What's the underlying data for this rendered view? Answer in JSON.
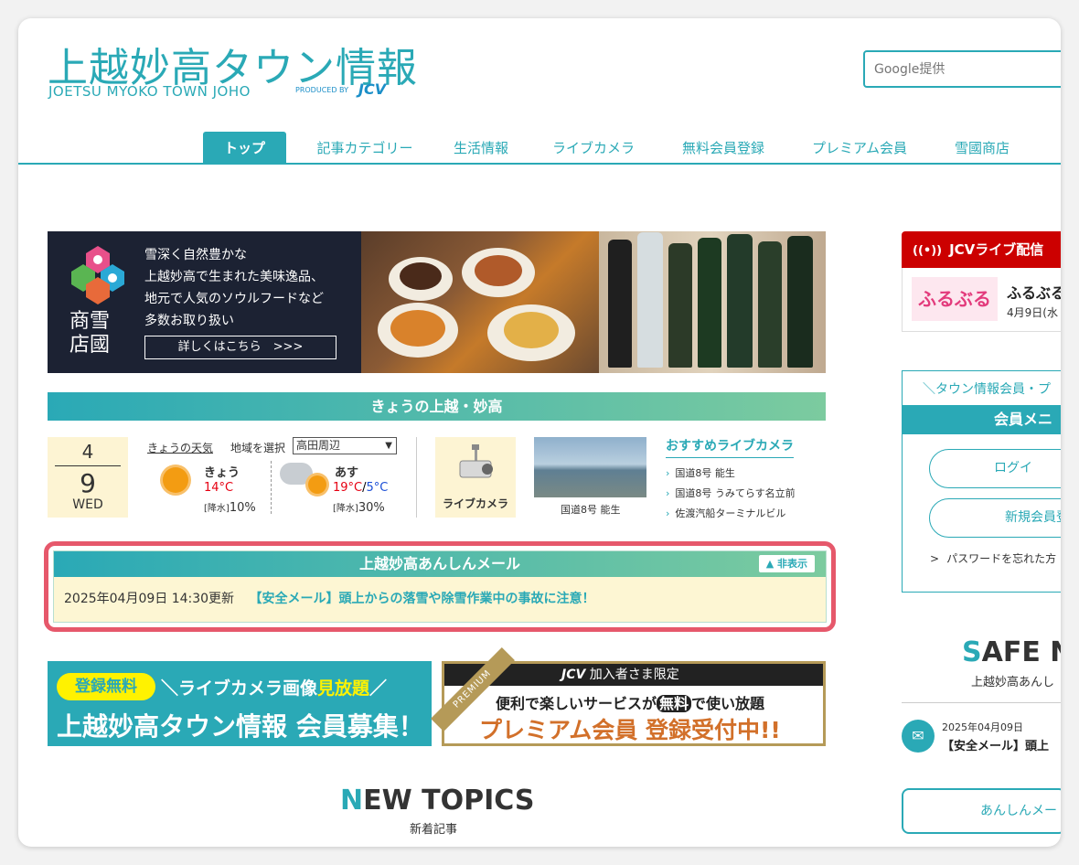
{
  "header": {
    "site_title": "上越妙高タウン情報",
    "site_subtitle": "JOETSU MYOKO TOWN JOHO",
    "produced_by": "PRODUCED BY",
    "brand": "JCV",
    "search_placeholder": "Google提供"
  },
  "nav": {
    "items": [
      "トップ",
      "記事カテゴリー",
      "生活情報",
      "ライブカメラ",
      "無料会員登録",
      "プレミアム会員",
      "雪國商店"
    ]
  },
  "banner": {
    "lines": [
      "雪深く自然豊かな",
      "上越妙高で生まれた美味逸品、",
      "地元で人気のソウルフードなど",
      "多数お取り扱い"
    ],
    "button_label": "詳しくはこちら　>>>",
    "shop_name": "商雪\n店國"
  },
  "today": {
    "heading": "きょうの上越・妙高",
    "month": "4",
    "day": "9",
    "weekday": "WED",
    "weather_link": "きょうの天気",
    "region_label": "地域を選択",
    "region_value": "高田周辺",
    "today_label": "きょう",
    "today_temp": "14°C",
    "today_rain_label": "[降水]",
    "today_rain": "10%",
    "tomorrow_label": "あす",
    "tomorrow_high": "19°C",
    "tomorrow_sep": "/",
    "tomorrow_low": "5°C",
    "tomorrow_rain_label": "[降水]",
    "tomorrow_rain": "30%",
    "camera_label": "ライブカメラ",
    "camera_thumb_caption": "国道8号 能生",
    "recommend_title": "おすすめライブカメラ",
    "recommend_links": [
      "国道8号 能生",
      "国道8号 うみてらす名立前",
      "佐渡汽船ターミナルビル"
    ]
  },
  "alert": {
    "title": "上越妙高あんしんメール",
    "hide_label": "▲ 非表示",
    "updated": "2025年04月09日 14:30更新",
    "message": "【安全メール】頭上からの落雪や除雪作業中の事故に注意！"
  },
  "promo1": {
    "badge": "登録無料",
    "line1_a": "＼ライブカメラ画像",
    "line1_b": "見放題",
    "line1_c": "／",
    "line2": "上越妙高タウン情報 会員募集！"
  },
  "promo2": {
    "ribbon": "PREMIUM",
    "head_brand": "JCV",
    "head_text": "加入者さま限定",
    "line1_a": "便利で楽しいサービスが",
    "line1_b": "無料",
    "line1_c": "で使い放題",
    "line2": "プレミアム会員 登録受付中!!"
  },
  "new_topics": {
    "title_first": "N",
    "title_rest": "EW TOPICS",
    "subtitle": "新着記事"
  },
  "sidebar": {
    "live_title": "JCVライブ配信",
    "live_logo": "ふるぶる",
    "live_name": "ふるぶる",
    "live_date": "4月9日(水",
    "member_tagline": "＼タウン情報会員・プ",
    "member_menu": "会員メニ",
    "login": "ログイ",
    "register": "新規会員登",
    "forgot": "パスワードを忘れた方",
    "safe_first": "S",
    "safe_rest": "AFE N",
    "safe_sub": "上越妙高あんし",
    "mail_date": "2025年04月09日",
    "mail_title": "【安全メール】頭上",
    "anshin_btn": "あんしんメー"
  },
  "colors": {
    "accent": "#2aa9b6",
    "alert_border": "#e6586b",
    "live_red": "#cc0000",
    "temp_high": "#e60012",
    "temp_low": "#1c4fd6"
  }
}
